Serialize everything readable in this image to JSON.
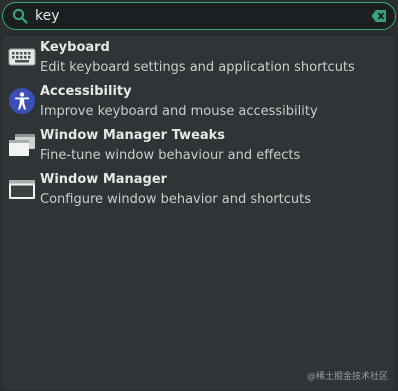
{
  "search": {
    "value": "key",
    "icon": "search-icon",
    "clear_icon": "clear-icon"
  },
  "colors": {
    "accent": "#3aa57a",
    "background": "#2a2e30",
    "panel": "#2f3436",
    "text": "#e6e8e8",
    "accessibility_blue": "#3b4fb8"
  },
  "results": [
    {
      "title": "Keyboard",
      "description": "Edit keyboard settings and application shortcuts",
      "icon": "keyboard-icon"
    },
    {
      "title": "Accessibility",
      "description": "Improve keyboard and mouse accessibility",
      "icon": "accessibility-icon"
    },
    {
      "title": "Window Manager Tweaks",
      "description": "Fine-tune window behaviour and effects",
      "icon": "window-manager-tweaks-icon"
    },
    {
      "title": "Window Manager",
      "description": "Configure window behavior and shortcuts",
      "icon": "window-manager-icon"
    }
  ],
  "watermark": "@稀土掘金技术社区"
}
